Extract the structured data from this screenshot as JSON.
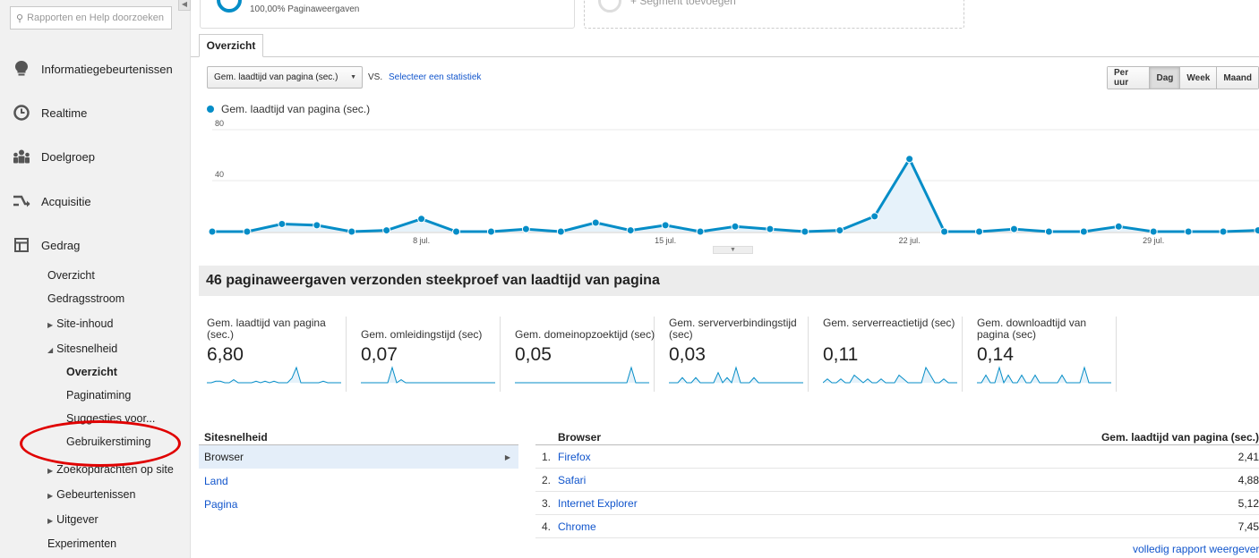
{
  "sidebar": {
    "search_placeholder": "Rapporten en Help doorzoeken",
    "nav_top": [
      {
        "label": "Informatiegebeurtenissen",
        "icon": "lightbulb-icon"
      },
      {
        "label": "Realtime",
        "icon": "clock-icon"
      },
      {
        "label": "Doelgroep",
        "icon": "people-icon"
      },
      {
        "label": "Acquisitie",
        "icon": "arrows-icon"
      },
      {
        "label": "Gedrag",
        "icon": "layout-icon"
      }
    ],
    "gedrag": {
      "overzicht": "Overzicht",
      "gedragsstroom": "Gedragsstroom",
      "site_inhoud": "Site-inhoud",
      "sitesnelheid": "Sitesnelheid",
      "sitesnelheid_sub": {
        "overzicht": "Overzicht",
        "paginatiming": "Paginatiming",
        "suggesties": "Suggesties voor...",
        "gebruikerstiming": "Gebruikerstiming"
      },
      "zoekopdrachten": "Zoekopdrachten op site",
      "gebeurtenissen": "Gebeurtenissen",
      "uitgever": "Uitgever",
      "experimenten": "Experimenten"
    }
  },
  "segments": {
    "primary_pct": "100,00% Paginaweergaven",
    "add_segment": "+ Segment toevoegen"
  },
  "tab": {
    "label": "Overzicht"
  },
  "controls": {
    "metric": "Gem. laadtijd van pagina (sec.)",
    "vs": "VS.",
    "select_stat": "Selecteer een statistiek",
    "periods": [
      "Per uur",
      "Dag",
      "Week",
      "Maand"
    ],
    "active_period": "Dag"
  },
  "chart_data": {
    "type": "area",
    "series": [
      {
        "name": "Gem. laadtijd van pagina (sec.)",
        "values": [
          0,
          0,
          6,
          5,
          0,
          1,
          10,
          0,
          0,
          2,
          0,
          7,
          1,
          5,
          0,
          4,
          2,
          0,
          1,
          12,
          57,
          0,
          0,
          2,
          0,
          0,
          4,
          0,
          0,
          0,
          1
        ]
      }
    ],
    "x_tick_labels": [
      "8 jul.",
      "15 jul.",
      "22 jul.",
      "29 jul."
    ],
    "x_tick_indices": [
      6,
      13,
      20,
      27
    ],
    "y_ticks": [
      40,
      80
    ],
    "ylim": [
      0,
      80
    ],
    "grid": true,
    "color": "#058dc7"
  },
  "sample_heading": "46 paginaweergaven verzonden steekproef van laadtijd van pagina",
  "scorecards": [
    {
      "label": "Gem. laadtijd van pagina (sec.)",
      "value": "6,80"
    },
    {
      "label": "Gem. omleidingstijd (sec)",
      "value": "0,07"
    },
    {
      "label": "Gem. domeinopzoektijd (sec)",
      "value": "0,05"
    },
    {
      "label": "Gem. serververbindingstijd (sec)",
      "value": "0,03"
    },
    {
      "label": "Gem. serverreactietijd (sec)",
      "value": "0,11"
    },
    {
      "label": "Gem. downloadtijd van pagina (sec)",
      "value": "0,14"
    }
  ],
  "left_table": {
    "header": "Sitesnelheid",
    "rows": [
      "Browser",
      "Land",
      "Pagina"
    ]
  },
  "right_table": {
    "col1": "Browser",
    "col2": "Gem. laadtijd van pagina (sec.)",
    "rows": [
      {
        "num": "1.",
        "name": "Firefox",
        "value": "2,41"
      },
      {
        "num": "2.",
        "name": "Safari",
        "value": "4,88"
      },
      {
        "num": "3.",
        "name": "Internet Explorer",
        "value": "5,12"
      },
      {
        "num": "4.",
        "name": "Chrome",
        "value": "7,45"
      }
    ]
  },
  "full_report": "volledig rapport weergeven"
}
